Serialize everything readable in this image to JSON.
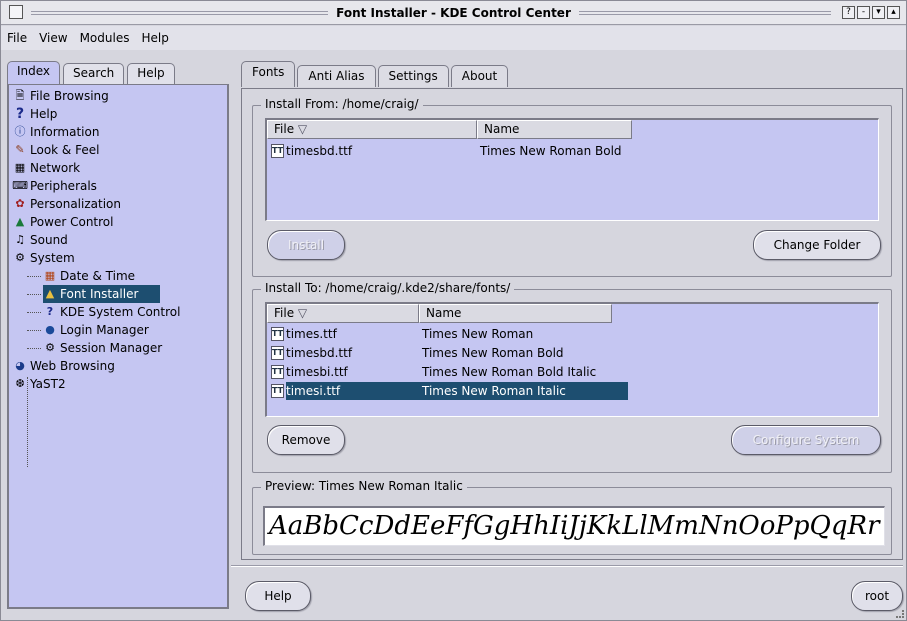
{
  "window": {
    "title": "Font Installer - KDE Control Center",
    "title_buttons": [
      "?",
      "-",
      "▾",
      "▴"
    ]
  },
  "menubar": [
    "File",
    "View",
    "Modules",
    "Help"
  ],
  "left_tabs": [
    {
      "label": "Index",
      "active": true
    },
    {
      "label": "Search",
      "active": false
    },
    {
      "label": "Help",
      "active": false
    }
  ],
  "tree": [
    {
      "label": "File Browsing",
      "icon": "file-browsing-icon"
    },
    {
      "label": "Help",
      "icon": "help-icon"
    },
    {
      "label": "Information",
      "icon": "information-icon"
    },
    {
      "label": "Look & Feel",
      "icon": "look-feel-icon"
    },
    {
      "label": "Network",
      "icon": "network-icon"
    },
    {
      "label": "Peripherals",
      "icon": "peripherals-icon"
    },
    {
      "label": "Personalization",
      "icon": "personalization-icon"
    },
    {
      "label": "Power Control",
      "icon": "power-control-icon"
    },
    {
      "label": "Sound",
      "icon": "sound-icon"
    },
    {
      "label": "System",
      "icon": "system-icon"
    },
    {
      "label": "Date & Time",
      "icon": "date-time-icon",
      "child": true
    },
    {
      "label": "Font Installer",
      "icon": "font-installer-icon",
      "child": true,
      "selected": true
    },
    {
      "label": "KDE System Control",
      "icon": "kde-system-control-icon",
      "child": true
    },
    {
      "label": "Login Manager",
      "icon": "login-manager-icon",
      "child": true
    },
    {
      "label": "Session Manager",
      "icon": "session-manager-icon",
      "child": true
    },
    {
      "label": "Web Browsing",
      "icon": "web-browsing-icon"
    },
    {
      "label": "YaST2",
      "icon": "yast2-icon"
    }
  ],
  "right_tabs": [
    {
      "label": "Fonts",
      "active": true
    },
    {
      "label": "Anti Alias",
      "active": false
    },
    {
      "label": "Settings",
      "active": false
    },
    {
      "label": "About",
      "active": false
    }
  ],
  "install_from": {
    "legend": "Install From: /home/craig/",
    "col_file": "File",
    "col_name": "Name",
    "rows": [
      {
        "file": "timesbd.ttf",
        "name": "Times New Roman Bold"
      }
    ],
    "install_button": "Install",
    "change_folder_button": "Change Folder"
  },
  "install_to": {
    "legend": "Install To: /home/craig/.kde2/share/fonts/",
    "col_file": "File",
    "col_name": "Name",
    "rows": [
      {
        "file": "times.ttf",
        "name": "Times New Roman"
      },
      {
        "file": "timesbd.ttf",
        "name": "Times New Roman Bold"
      },
      {
        "file": "timesbi.ttf",
        "name": "Times New Roman Bold Italic"
      },
      {
        "file": "timesi.ttf",
        "name": "Times New Roman Italic",
        "selected": true
      }
    ],
    "remove_button": "Remove",
    "configure_button": "Configure System"
  },
  "preview": {
    "legend": "Preview: Times New Roman Italic",
    "sample": "AaBbCcDdEeFfGgHhIiJjKkLlMmNnOoPpQqRr"
  },
  "bottom": {
    "help_button": "Help",
    "root_button": "root"
  },
  "colors": {
    "list_background": "#c5c6f2",
    "selection": "#1d4e70",
    "window": "#d6d6de"
  }
}
